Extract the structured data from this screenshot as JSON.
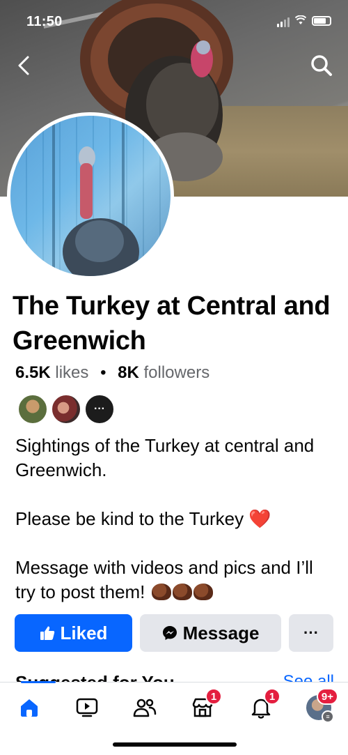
{
  "status_bar": {
    "time": "11:50"
  },
  "header": {
    "back_icon": "chevron-left-icon",
    "search_icon": "search-icon"
  },
  "page": {
    "name": "The Turkey at Central and Greenwich",
    "likes_count": "6.5K",
    "likes_label": "likes",
    "followers_count": "8K",
    "followers_label": "followers",
    "more_friends_label": "···",
    "about": [
      "Sightings of the Turkey at central and Greenwich.",
      "Please be kind to the Turkey",
      "Message with videos and pics and I’ll try to post them!"
    ],
    "heart_glyph": "❤️"
  },
  "actions": {
    "liked_label": "Liked",
    "message_label": "Message",
    "more_label": "···"
  },
  "suggested": {
    "title": "Suggested for You",
    "see_all": "See all"
  },
  "tabbar": {
    "marketplace_badge": "1",
    "notifications_badge": "1",
    "menu_badge": "9+"
  },
  "colors": {
    "accent": "#0866ff",
    "badge": "#e41e3f",
    "button_gray": "#e4e6eb",
    "secondary_text": "#65676b"
  }
}
